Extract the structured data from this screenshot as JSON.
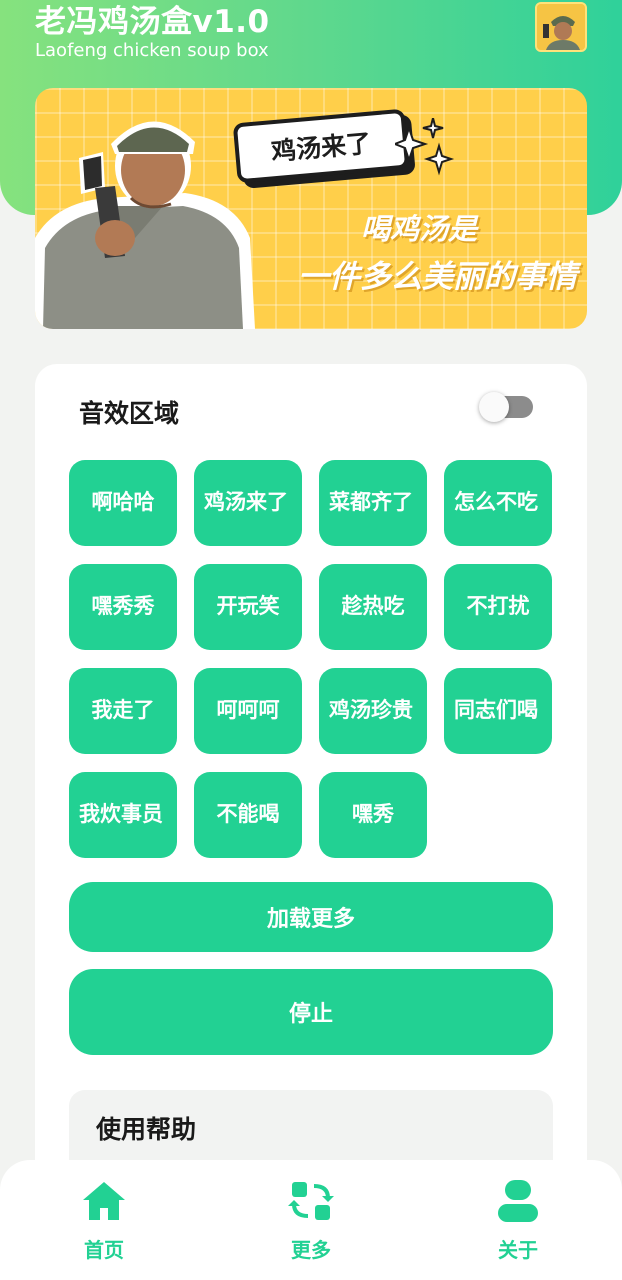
{
  "header": {
    "title": "老冯鸡汤盒v1.0",
    "subtitle": "Laofeng chicken soup box",
    "avatar_icon": "avatar-portrait"
  },
  "banner": {
    "bubble_text": "鸡汤来了",
    "slogan_line1": "喝鸡汤是",
    "slogan_line2": "一件多么美丽的事情"
  },
  "sound_section": {
    "title": "音效区域",
    "toggle_on": false,
    "buttons": [
      {
        "label": "啊哈哈"
      },
      {
        "label": "鸡汤来了"
      },
      {
        "label": "菜都齐了"
      },
      {
        "label": "怎么不吃"
      },
      {
        "label": "嘿秀秀"
      },
      {
        "label": "开玩笑"
      },
      {
        "label": "趁热吃"
      },
      {
        "label": "不打扰"
      },
      {
        "label": "我走了"
      },
      {
        "label": "呵呵呵"
      },
      {
        "label": "鸡汤珍贵"
      },
      {
        "label": "同志们喝"
      },
      {
        "label": "我炊事员"
      },
      {
        "label": "不能喝"
      },
      {
        "label": "嘿秀"
      }
    ],
    "load_more_label": "加载更多",
    "stop_label": "停止"
  },
  "help": {
    "title": "使用帮助"
  },
  "tabbar": {
    "items": [
      {
        "label": "首页",
        "icon": "home-icon"
      },
      {
        "label": "更多",
        "icon": "swap-icon"
      },
      {
        "label": "关于",
        "icon": "user-icon"
      }
    ]
  },
  "colors": {
    "accent": "#22d193",
    "header_gradient_start": "#86e27e",
    "header_gradient_end": "#2fd19a",
    "banner_bg": "#ffcf4a"
  }
}
